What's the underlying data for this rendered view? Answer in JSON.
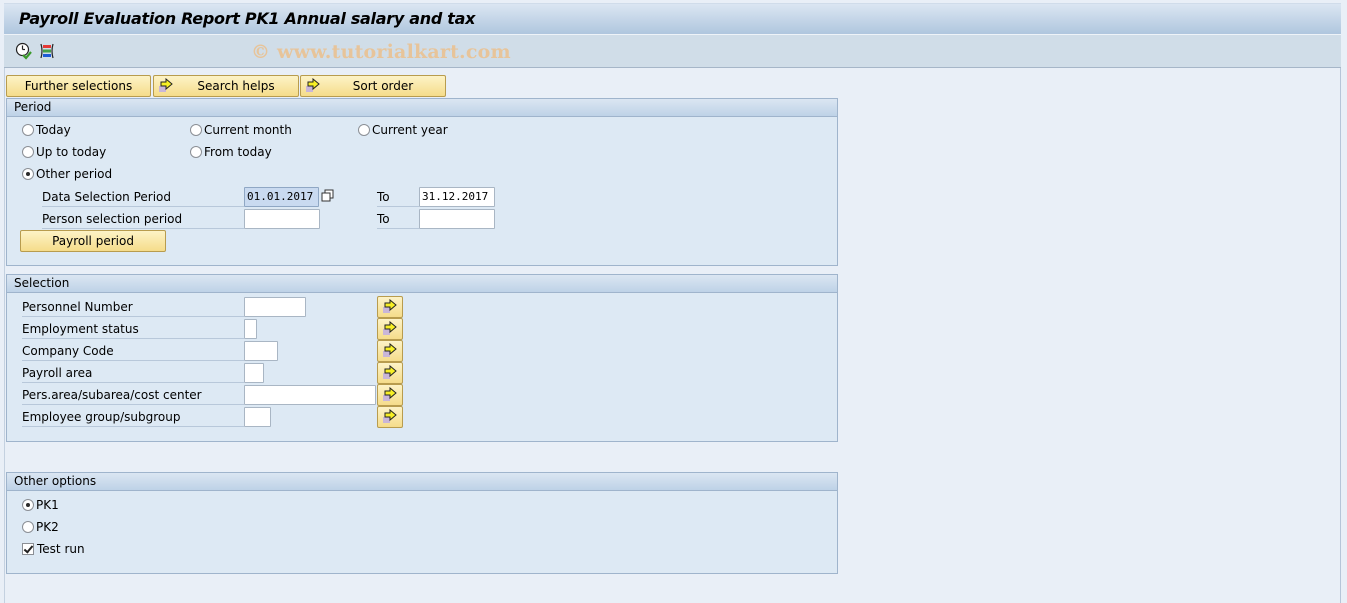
{
  "window": {
    "title": "Payroll Evaluation Report PK1 Annual salary and tax",
    "watermark": "© www.tutorialkart.com"
  },
  "toolbar": {
    "icons": [
      "execute-icon",
      "selection-screen-icon"
    ]
  },
  "app_buttons": [
    {
      "label": "Further selections",
      "icon": null
    },
    {
      "label": "Search helps",
      "icon": "arrow-right-icon"
    },
    {
      "label": "Sort order",
      "icon": "arrow-right-icon"
    }
  ],
  "period": {
    "title": "Period",
    "radios": [
      {
        "label": "Today",
        "selected": false
      },
      {
        "label": "Current month",
        "selected": false
      },
      {
        "label": "Current year",
        "selected": false
      },
      {
        "label": "Up to today",
        "selected": false
      },
      {
        "label": "From today",
        "selected": false
      },
      {
        "label": "Other period",
        "selected": true
      }
    ],
    "data_selection": {
      "label": "Data Selection Period",
      "from": "01.01.2017",
      "to_label": "To",
      "to": "31.12.2017"
    },
    "person_selection": {
      "label": "Person selection period",
      "from": "",
      "to_label": "To",
      "to": ""
    },
    "payroll_period_button": "Payroll period"
  },
  "selection": {
    "title": "Selection",
    "fields": [
      {
        "label": "Personnel Number",
        "value": ""
      },
      {
        "label": "Employment status",
        "value": ""
      },
      {
        "label": "Company Code",
        "value": ""
      },
      {
        "label": "Payroll area",
        "value": ""
      },
      {
        "label": "Pers.area/subarea/cost center",
        "value": ""
      },
      {
        "label": "Employee group/subgroup",
        "value": ""
      }
    ]
  },
  "other_options": {
    "title": "Other options",
    "radios": [
      {
        "label": "PK1",
        "selected": true
      },
      {
        "label": "PK2",
        "selected": false
      }
    ],
    "test_run": {
      "label": "Test run",
      "checked": true
    }
  }
}
